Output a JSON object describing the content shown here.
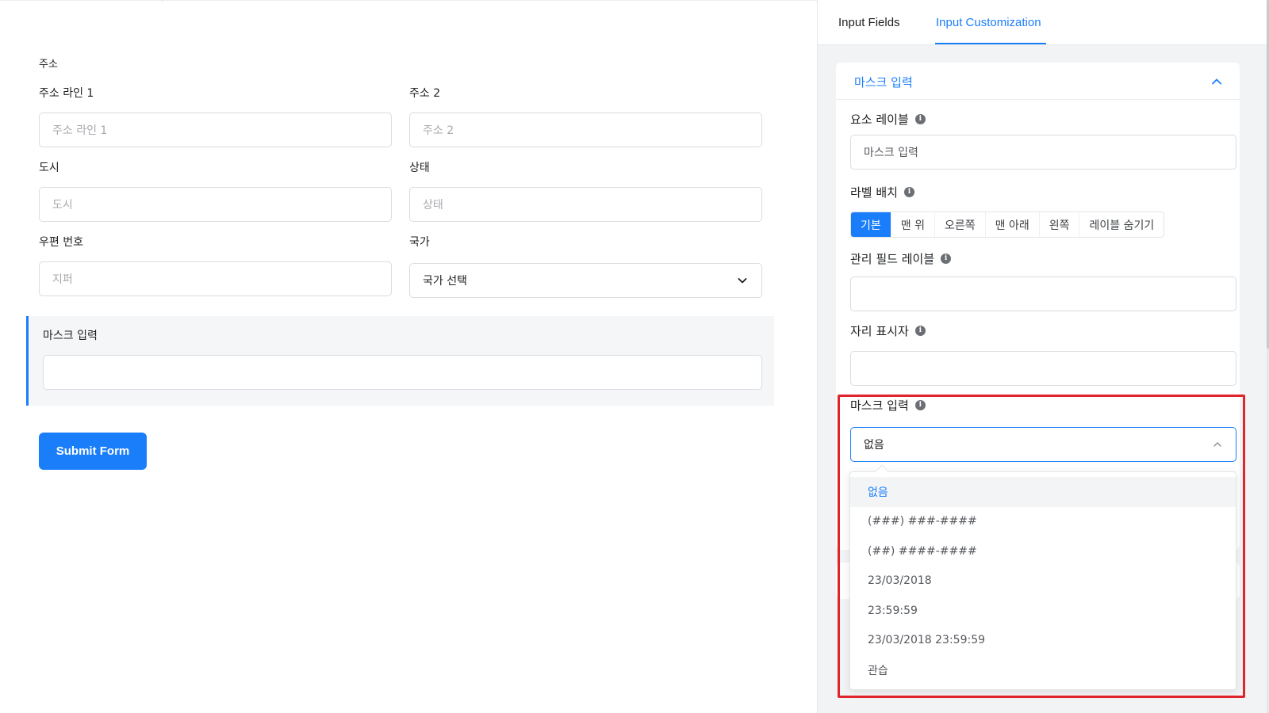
{
  "form": {
    "address_section_label": "주소",
    "fields": {
      "address_line1": {
        "label": "주소 라인 1",
        "placeholder": "주소 라인 1"
      },
      "address_line2": {
        "label": "주소 2",
        "placeholder": "주소 2"
      },
      "city": {
        "label": "도시",
        "placeholder": "도시"
      },
      "state": {
        "label": "상태",
        "placeholder": "상태"
      },
      "zip": {
        "label": "우편 번호",
        "placeholder": "지퍼"
      },
      "country": {
        "label": "국가",
        "value": "국가 선택"
      }
    },
    "mask_field": {
      "label": "마스크 입력",
      "value": ""
    },
    "submit_label": "Submit Form"
  },
  "panel": {
    "tabs": [
      {
        "label": "Input Fields",
        "active": false
      },
      {
        "label": "Input Customization",
        "active": true
      }
    ],
    "card_title": "마스크 입력",
    "element_label": {
      "label": "요소 레이블",
      "value": "마스크 입력"
    },
    "label_placement": {
      "label": "라벨 배치",
      "options": [
        "기본",
        "맨 위",
        "오른쪽",
        "맨 아래",
        "왼쪽",
        "레이블 숨기기"
      ],
      "selected": "기본"
    },
    "admin_field_label": {
      "label": "관리 필드 레이블",
      "value": ""
    },
    "placeholder": {
      "label": "자리 표시자",
      "value": ""
    },
    "mask_input": {
      "label": "마스크 입력",
      "value": "없음",
      "options": [
        "없음",
        "(###) ###-####",
        "(##) ####-####",
        "23/03/2018",
        "23:59:59",
        "23/03/2018 23:59:59",
        "관습"
      ]
    }
  },
  "colors": {
    "accent": "#1a7efb",
    "highlight": "#e0242b"
  }
}
